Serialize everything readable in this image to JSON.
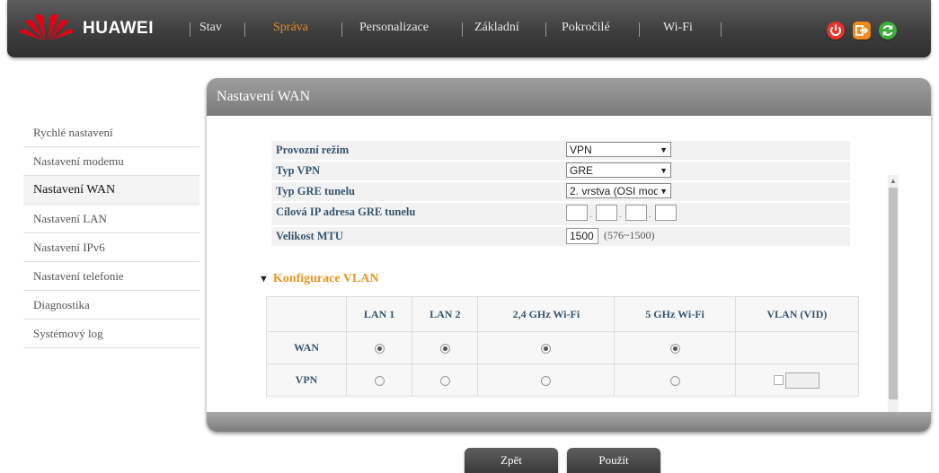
{
  "header": {
    "brand": "HUAWEI",
    "nav": [
      "Stav",
      "Správa",
      "Personalizace",
      "Základní",
      "Pokročilé",
      "Wi-Fi"
    ],
    "active_nav": "Správa",
    "icons": [
      "power-icon",
      "logout-icon",
      "refresh-icon"
    ],
    "accent_color": "#e88a1d"
  },
  "sidebar": {
    "items": [
      {
        "label": "Rychlé nastavení"
      },
      {
        "label": "Nastavení modemu"
      },
      {
        "label": "Nastavení WAN"
      },
      {
        "label": "Nastavení LAN"
      },
      {
        "label": "Nastavení IPv6"
      },
      {
        "label": "Nastavení telefonie"
      },
      {
        "label": "Diagnostika"
      },
      {
        "label": "Systémový log"
      }
    ],
    "active": "Nastavení WAN"
  },
  "panel": {
    "title": "Nastavení WAN",
    "form": {
      "mode_label": "Provozní režim",
      "mode_value": "VPN",
      "vpn_type_label": "Typ VPN",
      "vpn_type_value": "GRE",
      "gre_type_label": "Typ GRE tunelu",
      "gre_type_value": "2. vrstva (OSI mod",
      "gre_ip_label": "Cílová IP adresa GRE tunelu",
      "gre_ip_value": [
        "",
        "",
        "",
        ""
      ],
      "mtu_label": "Velikost MTU",
      "mtu_value": "1500",
      "mtu_range": "(576~1500)"
    },
    "vlan": {
      "title": "Konfigurace VLAN",
      "columns": [
        "",
        "LAN 1",
        "LAN 2",
        "2,4 GHz Wi-Fi",
        "5 GHz Wi-Fi",
        "VLAN (VID)"
      ],
      "rows": [
        {
          "label": "WAN",
          "selected": [
            true,
            true,
            true,
            true
          ],
          "vid_enabled": false
        },
        {
          "label": "VPN",
          "selected": [
            false,
            false,
            false,
            false
          ],
          "vid_enabled": true,
          "vid_checked": false,
          "vid_value": ""
        }
      ]
    }
  },
  "buttons": {
    "back": "Zpět",
    "apply": "Použít"
  }
}
